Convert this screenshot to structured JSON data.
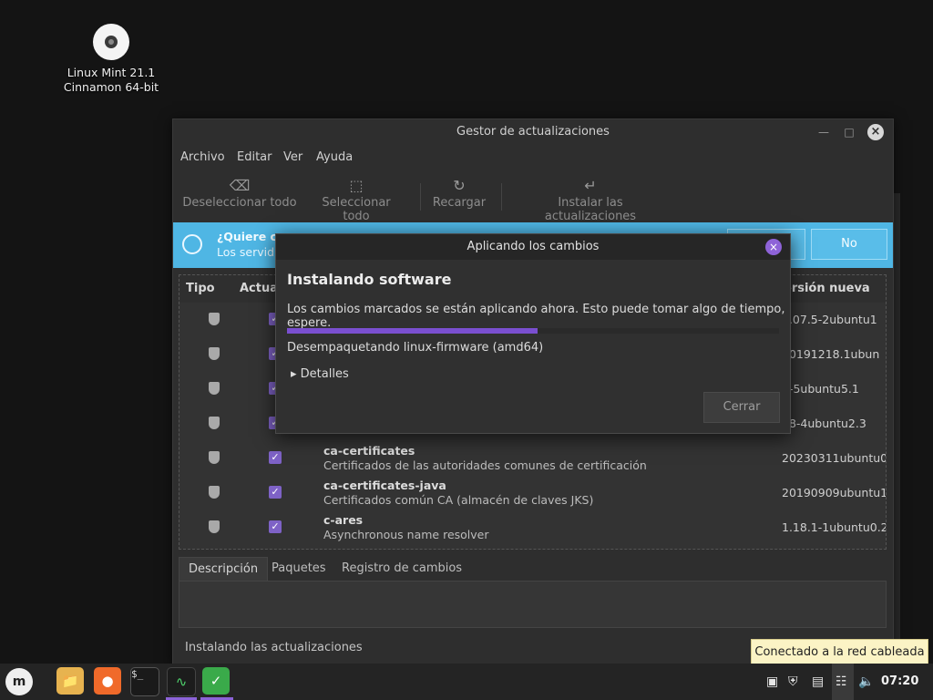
{
  "desktop": {
    "icon_line1": "Linux Mint 21.1",
    "icon_line2": "Cinnamon 64-bit"
  },
  "window": {
    "title": "Gestor de actualizaciones",
    "menu": [
      "Archivo",
      "Editar",
      "Ver",
      "Ayuda"
    ],
    "toolbar": {
      "deselect": "Deseleccionar todo",
      "select": "Seleccionar todo",
      "reload": "Recargar",
      "install": "Instalar las actualizaciones"
    },
    "infobar": {
      "line1": "¿Quiere ca",
      "line2": "Los servid",
      "yes": "",
      "no": "No"
    },
    "list": {
      "headers": {
        "type": "Tipo",
        "update": "Actual",
        "new_version": "ersión nueva"
      },
      "rows": [
        {
          "name": "",
          "desc": "",
          "version": "2.07.5-2ubuntu1"
        },
        {
          "name": "",
          "desc": "",
          "version": "20191218.1ubun"
        },
        {
          "name": "",
          "desc": "",
          "version": "8-5ubuntu5.1"
        },
        {
          "name": "",
          "desc": "",
          "version": "38-4ubuntu2.3"
        },
        {
          "name": "ca-certificates",
          "desc": "Certificados de las autoridades comunes de certificación",
          "version": "20230311ubuntu0"
        },
        {
          "name": "ca-certificates-java",
          "desc": "Certificados común CA (almacén de claves JKS)",
          "version": "20190909ubuntu1"
        },
        {
          "name": "c-ares",
          "desc": "Asynchronous name resolver",
          "version": "1.18.1-1ubuntu0.2"
        }
      ]
    },
    "tabs": [
      "Descripción",
      "Paquetes",
      "Registro de cambios"
    ],
    "status": "Instalando las actualizaciones"
  },
  "dialog": {
    "title": "Aplicando los cambios",
    "heading": "Instalando software",
    "message": "Los cambios marcados se están aplicando ahora. Esto puede tomar algo de tiempo, espere.",
    "progress": 0.51,
    "substatus": "Desempaquetando linux-firmware (amd64)",
    "details": "Detalles",
    "close_button": "Cerrar"
  },
  "tooltip": "Conectado a la red cableada",
  "taskbar": {
    "clock": "07:20"
  },
  "colors": {
    "accent": "#7a4fd0",
    "info": "#4fb6e4",
    "tooltip_bg": "#fbf3c5"
  },
  "icons": [
    "mint-menu-icon",
    "files-icon",
    "firefox-icon",
    "terminal-icon",
    "system-monitor-icon",
    "update-manager-icon",
    "notifications-icon",
    "shield-tray-icon",
    "clipboard-icon",
    "network-icon",
    "volume-icon"
  ]
}
